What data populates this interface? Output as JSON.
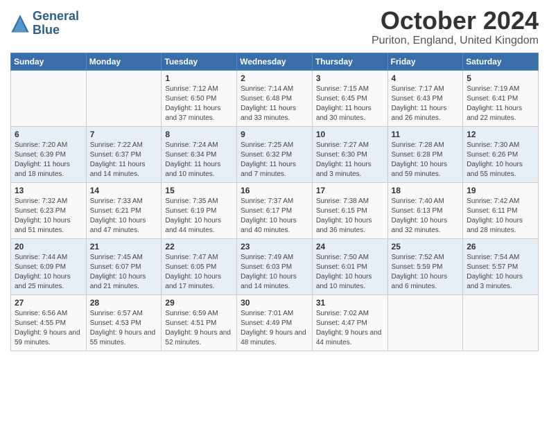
{
  "header": {
    "logo_line1": "General",
    "logo_line2": "Blue",
    "month_title": "October 2024",
    "location": "Puriton, England, United Kingdom"
  },
  "days_of_week": [
    "Sunday",
    "Monday",
    "Tuesday",
    "Wednesday",
    "Thursday",
    "Friday",
    "Saturday"
  ],
  "weeks": [
    [
      {
        "day": "",
        "info": ""
      },
      {
        "day": "",
        "info": ""
      },
      {
        "day": "1",
        "info": "Sunrise: 7:12 AM\nSunset: 6:50 PM\nDaylight: 11 hours and 37 minutes."
      },
      {
        "day": "2",
        "info": "Sunrise: 7:14 AM\nSunset: 6:48 PM\nDaylight: 11 hours and 33 minutes."
      },
      {
        "day": "3",
        "info": "Sunrise: 7:15 AM\nSunset: 6:45 PM\nDaylight: 11 hours and 30 minutes."
      },
      {
        "day": "4",
        "info": "Sunrise: 7:17 AM\nSunset: 6:43 PM\nDaylight: 11 hours and 26 minutes."
      },
      {
        "day": "5",
        "info": "Sunrise: 7:19 AM\nSunset: 6:41 PM\nDaylight: 11 hours and 22 minutes."
      }
    ],
    [
      {
        "day": "6",
        "info": "Sunrise: 7:20 AM\nSunset: 6:39 PM\nDaylight: 11 hours and 18 minutes."
      },
      {
        "day": "7",
        "info": "Sunrise: 7:22 AM\nSunset: 6:37 PM\nDaylight: 11 hours and 14 minutes."
      },
      {
        "day": "8",
        "info": "Sunrise: 7:24 AM\nSunset: 6:34 PM\nDaylight: 11 hours and 10 minutes."
      },
      {
        "day": "9",
        "info": "Sunrise: 7:25 AM\nSunset: 6:32 PM\nDaylight: 11 hours and 7 minutes."
      },
      {
        "day": "10",
        "info": "Sunrise: 7:27 AM\nSunset: 6:30 PM\nDaylight: 11 hours and 3 minutes."
      },
      {
        "day": "11",
        "info": "Sunrise: 7:28 AM\nSunset: 6:28 PM\nDaylight: 10 hours and 59 minutes."
      },
      {
        "day": "12",
        "info": "Sunrise: 7:30 AM\nSunset: 6:26 PM\nDaylight: 10 hours and 55 minutes."
      }
    ],
    [
      {
        "day": "13",
        "info": "Sunrise: 7:32 AM\nSunset: 6:23 PM\nDaylight: 10 hours and 51 minutes."
      },
      {
        "day": "14",
        "info": "Sunrise: 7:33 AM\nSunset: 6:21 PM\nDaylight: 10 hours and 47 minutes."
      },
      {
        "day": "15",
        "info": "Sunrise: 7:35 AM\nSunset: 6:19 PM\nDaylight: 10 hours and 44 minutes."
      },
      {
        "day": "16",
        "info": "Sunrise: 7:37 AM\nSunset: 6:17 PM\nDaylight: 10 hours and 40 minutes."
      },
      {
        "day": "17",
        "info": "Sunrise: 7:38 AM\nSunset: 6:15 PM\nDaylight: 10 hours and 36 minutes."
      },
      {
        "day": "18",
        "info": "Sunrise: 7:40 AM\nSunset: 6:13 PM\nDaylight: 10 hours and 32 minutes."
      },
      {
        "day": "19",
        "info": "Sunrise: 7:42 AM\nSunset: 6:11 PM\nDaylight: 10 hours and 28 minutes."
      }
    ],
    [
      {
        "day": "20",
        "info": "Sunrise: 7:44 AM\nSunset: 6:09 PM\nDaylight: 10 hours and 25 minutes."
      },
      {
        "day": "21",
        "info": "Sunrise: 7:45 AM\nSunset: 6:07 PM\nDaylight: 10 hours and 21 minutes."
      },
      {
        "day": "22",
        "info": "Sunrise: 7:47 AM\nSunset: 6:05 PM\nDaylight: 10 hours and 17 minutes."
      },
      {
        "day": "23",
        "info": "Sunrise: 7:49 AM\nSunset: 6:03 PM\nDaylight: 10 hours and 14 minutes."
      },
      {
        "day": "24",
        "info": "Sunrise: 7:50 AM\nSunset: 6:01 PM\nDaylight: 10 hours and 10 minutes."
      },
      {
        "day": "25",
        "info": "Sunrise: 7:52 AM\nSunset: 5:59 PM\nDaylight: 10 hours and 6 minutes."
      },
      {
        "day": "26",
        "info": "Sunrise: 7:54 AM\nSunset: 5:57 PM\nDaylight: 10 hours and 3 minutes."
      }
    ],
    [
      {
        "day": "27",
        "info": "Sunrise: 6:56 AM\nSunset: 4:55 PM\nDaylight: 9 hours and 59 minutes."
      },
      {
        "day": "28",
        "info": "Sunrise: 6:57 AM\nSunset: 4:53 PM\nDaylight: 9 hours and 55 minutes."
      },
      {
        "day": "29",
        "info": "Sunrise: 6:59 AM\nSunset: 4:51 PM\nDaylight: 9 hours and 52 minutes."
      },
      {
        "day": "30",
        "info": "Sunrise: 7:01 AM\nSunset: 4:49 PM\nDaylight: 9 hours and 48 minutes."
      },
      {
        "day": "31",
        "info": "Sunrise: 7:02 AM\nSunset: 4:47 PM\nDaylight: 9 hours and 44 minutes."
      },
      {
        "day": "",
        "info": ""
      },
      {
        "day": "",
        "info": ""
      }
    ]
  ]
}
